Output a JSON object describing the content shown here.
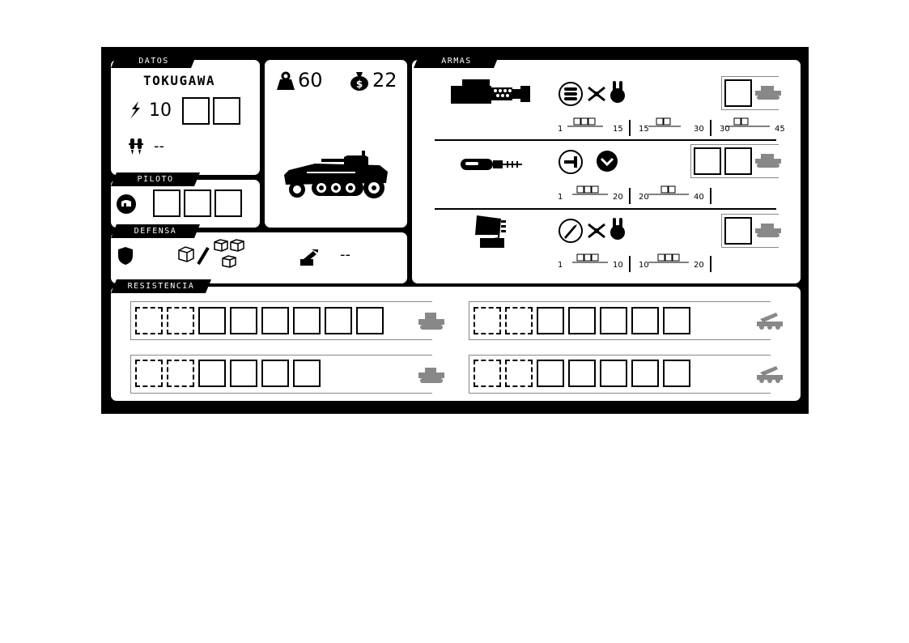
{
  "datos": {
    "tab": "DATOS",
    "name": "TOKUGAWA",
    "movement": "10",
    "jump": "--"
  },
  "stats": {
    "weight": "60",
    "cost": "22"
  },
  "piloto": {
    "tab": "PILOTO"
  },
  "defensa": {
    "tab": "DEFENSA",
    "anti_missile": "--"
  },
  "resistencia": {
    "tab": "RESISTENCIA"
  },
  "armas": {
    "tab": "ARMAS",
    "weapons": [
      {
        "name": "cannon",
        "ranges": [
          {
            "min": "1",
            "max": "15",
            "dice": 3
          },
          {
            "min": "15",
            "max": "30",
            "dice": 2
          },
          {
            "min": "30",
            "max": "45",
            "dice": 2
          }
        ]
      },
      {
        "name": "rifle",
        "ranges": [
          {
            "min": "1",
            "max": "20",
            "dice": 3
          },
          {
            "min": "20",
            "max": "40",
            "dice": 2
          }
        ]
      },
      {
        "name": "launcher",
        "ranges": [
          {
            "min": "1",
            "max": "10",
            "dice": 3
          },
          {
            "min": "10",
            "max": "20",
            "dice": 3
          }
        ]
      }
    ]
  },
  "icons": [
    "speed-icon",
    "jump-jet-icon",
    "weight-icon",
    "money-bag-icon",
    "pilot-helmet-icon",
    "shield-icon",
    "dice-icon",
    "anti-missile-icon",
    "tank-icon",
    "rocket-truck-icon"
  ],
  "colors": {
    "ink": "#000000",
    "paper": "#ffffff",
    "muted": "#888888"
  }
}
